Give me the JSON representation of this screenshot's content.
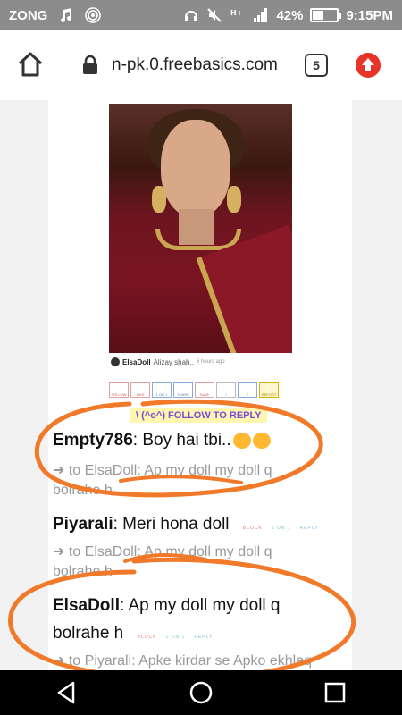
{
  "status_bar": {
    "carrier": "ZONG",
    "battery": "42%",
    "battery_fraction": 0.42,
    "time": "9:15PM",
    "left_icons": [
      "music-icon",
      "hotspot-icon"
    ],
    "right_icons": [
      "headset-icon",
      "mute-icon",
      "no-sim-icon",
      "signal-icon",
      "battery-icon"
    ]
  },
  "toolbar": {
    "url": "n-pk.0.freebasics.com",
    "tab_count": "5"
  },
  "post": {
    "username": "ElsaDoll",
    "caption": "Alizay shah..",
    "time": "6 hours ago",
    "actions": [
      "FOLLOW",
      "LIKE",
      "1 ON 1",
      "SHARE",
      "SAVE",
      "f",
      "T",
      "REPORT"
    ],
    "follow_reply": "\\ (^o^) FOLLOW TO REPLY"
  },
  "comments": [
    {
      "author": "Empty786",
      "text": ": Boy hai tbi..",
      "reply_to": "➜ to ElsaDoll: Ap my doll my doll q",
      "reply_cont": "bolrahe h"
    },
    {
      "author": "Piyarali",
      "text": ": Meri hona doll",
      "actions": [
        "BLOCK",
        "1 ON 1",
        "REPLY"
      ],
      "reply_to": "➜ to ElsaDoll: Ap my doll my doll q",
      "reply_cont": "bolrahe h"
    },
    {
      "author": "ElsaDoll",
      "text": ": Ap my doll my doll q",
      "text_cont": "bolrahe h",
      "actions": [
        "BLOCK",
        "1 ON 1",
        "REPLY"
      ],
      "reply_to": "➜ to Piyarali: Apke kirdar se Apko ekhlaq"
    }
  ],
  "colors": {
    "status_bar": "#8c8c8c",
    "annotation_ink": "#f07a2a",
    "follow_reply_bg": "#fff6b0",
    "follow_reply_text": "#7a4bd0",
    "update_badge": "#e8332a"
  },
  "nav": {
    "icons": [
      "back-icon",
      "home-icon",
      "recents-icon"
    ]
  }
}
